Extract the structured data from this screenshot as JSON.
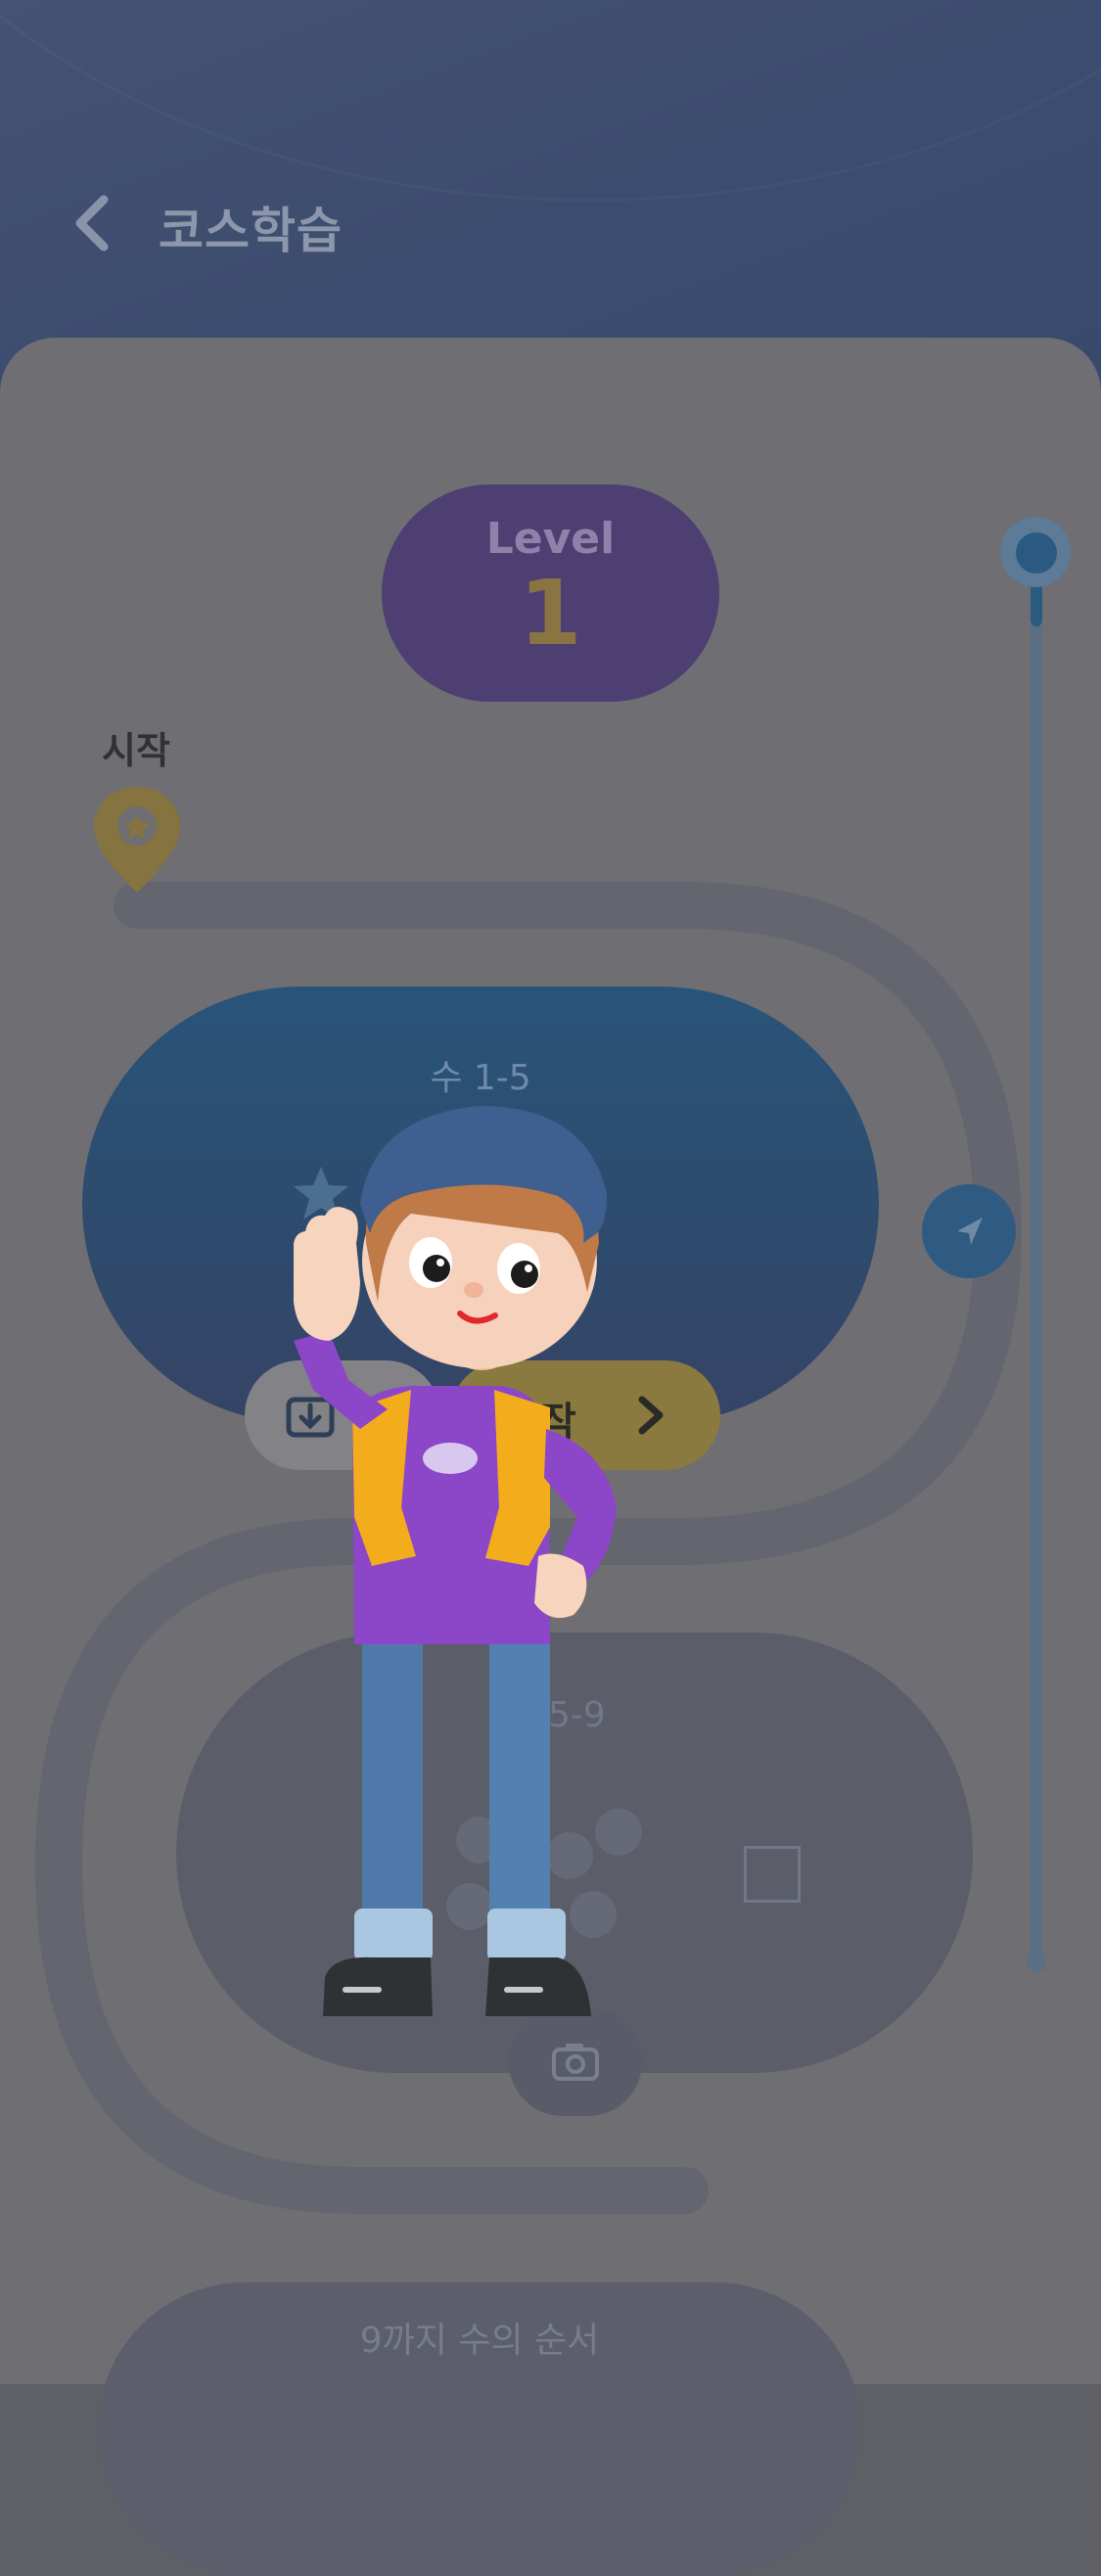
{
  "header": {
    "title": "코스학습",
    "back_icon": "chevron-left-icon"
  },
  "level": {
    "label": "Level",
    "number": "1"
  },
  "path": {
    "start_label": "시작",
    "start_icon": "star-map-pin-icon"
  },
  "stages": [
    {
      "title": "수 1-5",
      "stars": 2
    },
    {
      "title": "5-9"
    },
    {
      "title": "9까지 수의 순서"
    }
  ],
  "buttons": {
    "start_partial": "작",
    "download_icon": "download-icon",
    "arrow_icon": "chevron-right-icon",
    "nav_icon": "navigation-arrow-icon",
    "camera_icon": "camera-icon"
  },
  "colors": {
    "header": "#3f4e6e",
    "overlay": "#6e6e73",
    "level_badge": "#4e3f73",
    "accent_gold": "#8a7a3f"
  }
}
